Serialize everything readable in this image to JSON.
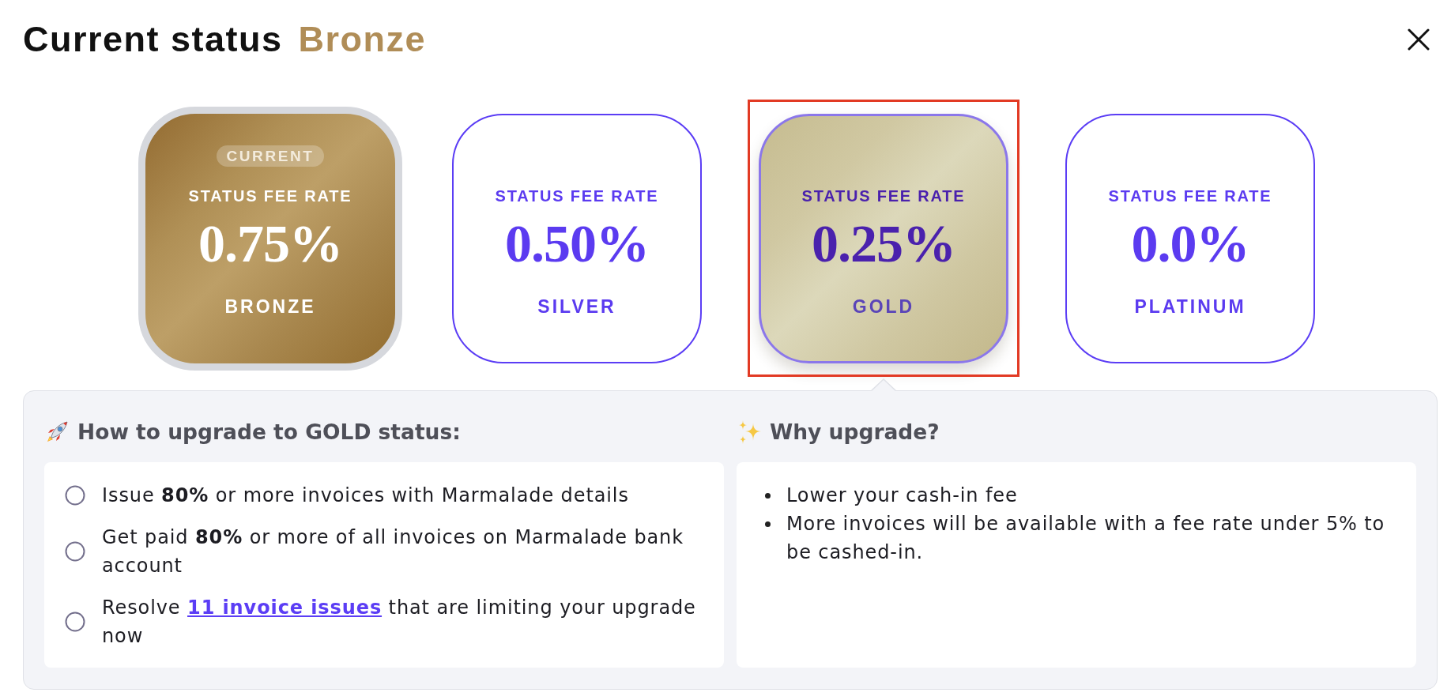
{
  "header": {
    "title": "Current status",
    "status": "Bronze"
  },
  "cards": [
    {
      "kind": "bronze",
      "badge": "CURRENT",
      "label": "STATUS FEE RATE",
      "rate": "0.75%",
      "tier": "BRONZE",
      "current": true,
      "selected": false,
      "highlighted": false
    },
    {
      "kind": "silver",
      "label": "STATUS FEE RATE",
      "rate": "0.50%",
      "tier": "SILVER",
      "current": false,
      "selected": false,
      "highlighted": false
    },
    {
      "kind": "gold",
      "label": "STATUS FEE RATE",
      "rate": "0.25%",
      "tier": "GOLD",
      "current": false,
      "selected": true,
      "highlighted": true
    },
    {
      "kind": "platinum",
      "label": "STATUS FEE RATE",
      "rate": "0.0%",
      "tier": "PLATINUM",
      "current": false,
      "selected": false,
      "highlighted": false
    }
  ],
  "upgrade": {
    "heading": "How to upgrade to GOLD status:",
    "requirements": [
      {
        "text": "Issue **80%** or more invoices with Marmalade details",
        "checked": false
      },
      {
        "text": "Get paid **80%** or more of all invoices on Marmalade bank account",
        "checked": false
      },
      {
        "text": "Resolve ",
        "link": "11 invoice issues",
        "text_after": " that are limiting your upgrade now",
        "checked": false
      }
    ]
  },
  "benefits": {
    "heading": "Why upgrade?",
    "items": [
      "Lower your cash-in fee",
      "More invoices will be available with a fee rate under 5% to be cashed-in."
    ]
  }
}
